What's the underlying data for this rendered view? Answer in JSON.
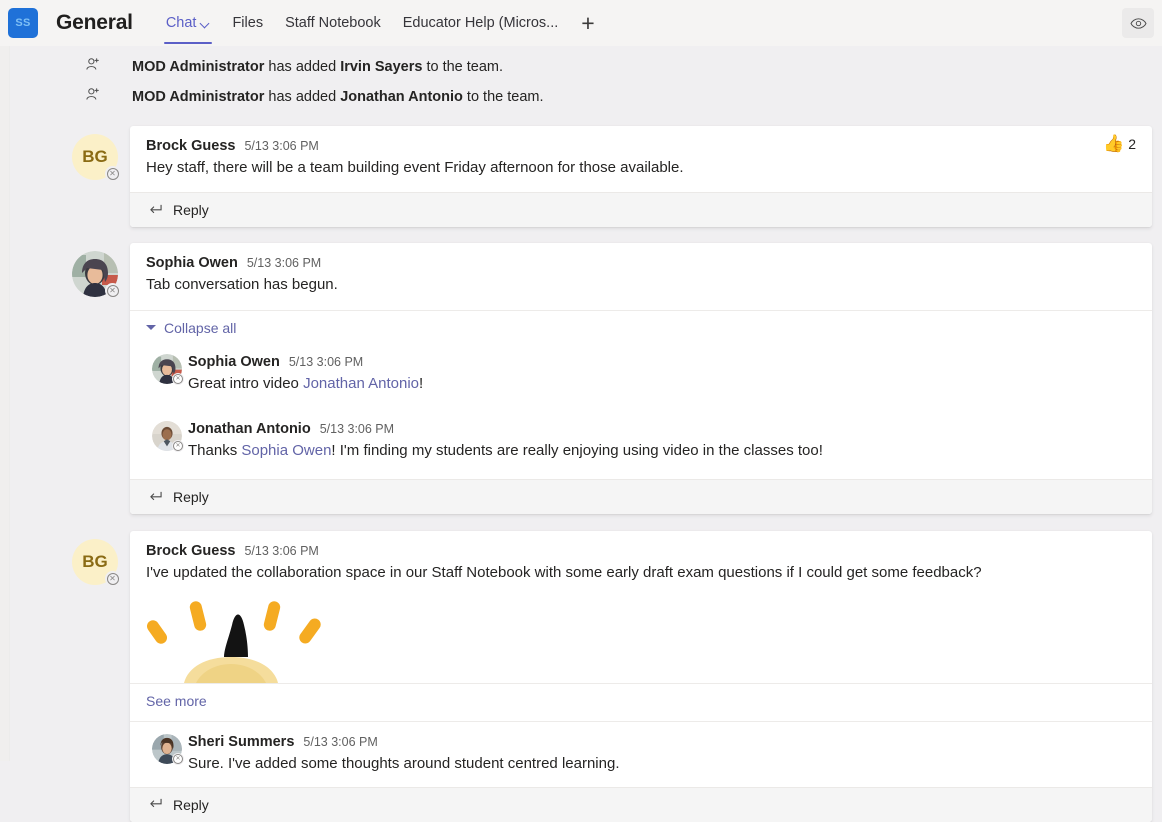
{
  "header": {
    "team_avatar_initials": "SS",
    "team_avatar_color": "#1f71d8",
    "channel_title": "General",
    "tabs": [
      {
        "label": "Chat",
        "active": true,
        "has_chevron": true
      },
      {
        "label": "Files",
        "active": false,
        "has_chevron": false
      },
      {
        "label": "Staff Notebook",
        "active": false,
        "has_chevron": false
      },
      {
        "label": "Educator Help (Micros...",
        "active": false,
        "has_chevron": false
      }
    ],
    "add_tab_label": "+",
    "eye_icon": "eye-icon",
    "accent_color": "#5b5fc7"
  },
  "system_messages": [
    {
      "icon": "person-add-icon",
      "actor": "MOD Administrator",
      "middle": " has added ",
      "target": "Irvin Sayers",
      "suffix": " to the team."
    },
    {
      "icon": "person-add-icon",
      "actor": "MOD Administrator",
      "middle": " has added ",
      "target": "Jonathan Antonio",
      "suffix": " to the team."
    }
  ],
  "messages": {
    "m1": {
      "author": "Brock Guess",
      "timestamp": "5/13 3:06 PM",
      "text": "Hey staff, there will be a team building event Friday afternoon for those available.",
      "avatar_initials": "BG",
      "avatar_type": "initials",
      "reaction_emoji": "👍",
      "reaction_count": "2",
      "reply_label": "Reply"
    },
    "m2": {
      "author": "Sophia Owen",
      "timestamp": "5/13 3:06 PM",
      "text": "Tab conversation has begun.",
      "avatar_type": "photo",
      "collapse_label": "Collapse all",
      "reply_label": "Reply",
      "replies": {
        "r1": {
          "author": "Sophia Owen",
          "timestamp": "5/13 3:06 PM",
          "text_before": "Great intro video ",
          "mention": "Jonathan Antonio",
          "text_after": "!"
        },
        "r2": {
          "author": "Jonathan Antonio",
          "timestamp": "5/13 3:06 PM",
          "text_before": "Thanks ",
          "mention": "Sophia Owen",
          "text_after": "! I'm finding my students are really enjoying using video in the classes too!"
        }
      }
    },
    "m3": {
      "author": "Brock Guess",
      "timestamp": "5/13 3:06 PM",
      "text": "I've updated the collaboration space in our Staff Notebook with some early draft exam questions if I could get some feedback?",
      "avatar_initials": "BG",
      "avatar_type": "initials",
      "attachment": "celebration-gif",
      "see_more_label": "See more",
      "nested": {
        "author": "Sheri Summers",
        "timestamp": "5/13 3:06 PM",
        "text": "Sure. I've added some thoughts around student centred learning.",
        "avatar_type": "photo"
      },
      "reply_label": "Reply"
    }
  }
}
